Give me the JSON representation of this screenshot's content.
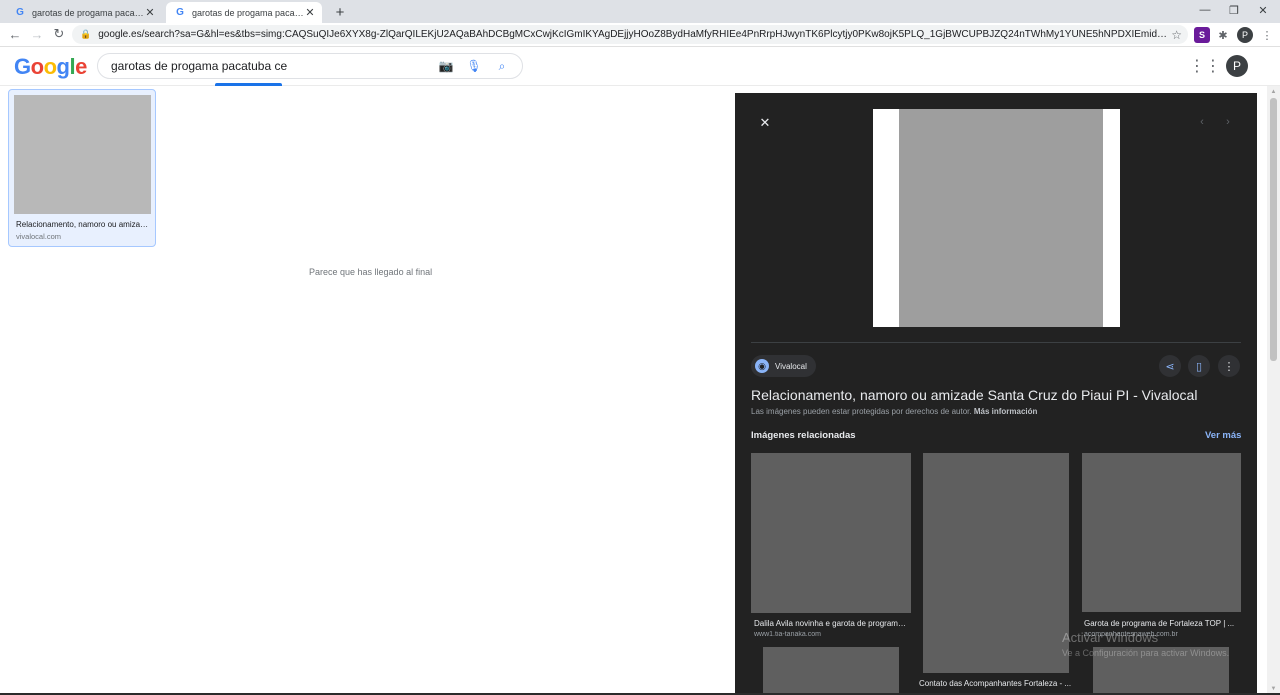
{
  "browser": {
    "tabs": [
      {
        "title": "garotas de progama pacatuba ce",
        "active": false
      },
      {
        "title": "garotas de progama pacatuba ce",
        "active": true
      }
    ],
    "new_tab_icon": "plus-icon",
    "url": "google.es/search?sa=G&hl=es&tbs=simg:CAQSuQIJe6XYX8g-ZlQarQILEKjU2AQaBAhDCBgMCxCwjKcIGmIKYAgDEjjyHOoZ8BydHaMfyRHIEe4PnRrpHJwynTK6Plcytjy0PKw8ojK5PLQ_1GjBWCUPBJZQ24nTWhMy1YUNE5hNPDXIEmidp6O5bqlElkgthC_1aZjHe3aef...",
    "profile_initial": "P"
  },
  "header": {
    "logo_letters": [
      "G",
      "o",
      "o",
      "g",
      "l",
      "e"
    ],
    "logo_colors": [
      "#4285f4",
      "#ea4335",
      "#fbbc05",
      "#4285f4",
      "#34a853",
      "#ea4335"
    ],
    "query": "garotas de progama pacatuba ce",
    "profile_initial": "P"
  },
  "results": [
    {
      "title": "Relacionamento, namoro ou amizade Santa Cruz do Piaui PI - Vivalocal",
      "site": "vivalocal.com"
    }
  ],
  "end_message": "Parece que has llegado al final",
  "panel": {
    "source": "Vivalocal",
    "title": "Relacionamento, namoro ou amizade Santa Cruz do Piaui PI - Vivalocal",
    "copyright": "Las imágenes pueden estar protegidas por derechos de autor.",
    "more_info": "Más información",
    "related_heading": "Imágenes relacionadas",
    "see_more": "Ver más",
    "related": [
      {
        "title": "Dalila Avila novinha e garota de programa ...",
        "site": "www1.tia-tanaka.com"
      },
      {
        "title": "Contato das Acompanhantes Fortaleza - ...",
        "site": ""
      },
      {
        "title": "Garota de programa de Fortaleza TOP | ...",
        "site": "acompanhantesnaweb.com.br"
      },
      {
        "title": "",
        "site": ""
      },
      {
        "title": "",
        "site": ""
      }
    ]
  },
  "watermark": {
    "line1": "Activar Windows",
    "line2": "Ve a Configuración para activar Windows."
  }
}
